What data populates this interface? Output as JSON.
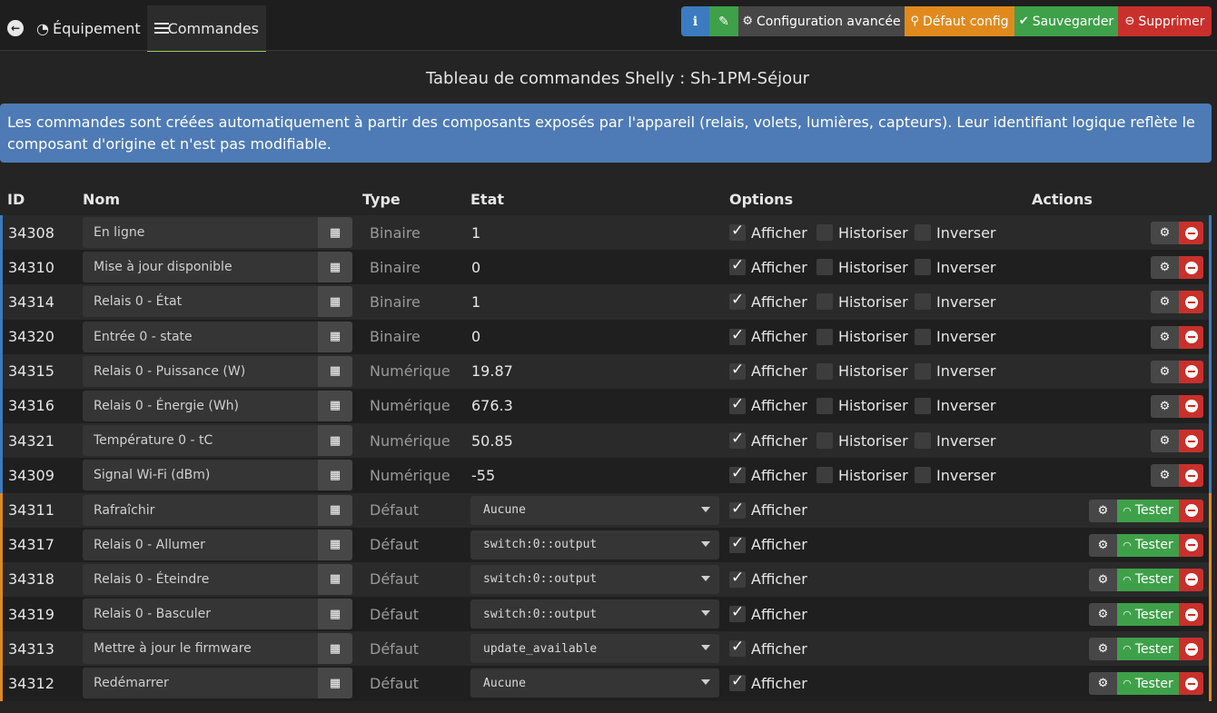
{
  "tabs": {
    "equipment": {
      "label": "Équipement",
      "icon": "tachometer-icon"
    },
    "commands": {
      "label": "Commandes",
      "icon": "list-icon"
    }
  },
  "toolbar": {
    "info_label": "i",
    "config_label": "Configuration avancée",
    "default_label": "Défaut config",
    "save_label": "Sauvegarder",
    "delete_label": "Supprimer"
  },
  "page_title": "Tableau de commandes Shelly : Sh-1PM-Séjour",
  "alert_text": "Les commandes sont créées automatiquement à partir des composants exposés par l'appareil (relais, volets, lumières, capteurs). Leur identifiant logique reflète le composant d'origine et n'est pas modifiable.",
  "table": {
    "headers": {
      "id": "ID",
      "name": "Nom",
      "type": "Type",
      "state": "Etat",
      "options": "Options",
      "actions": "Actions"
    },
    "option_labels": {
      "show": "Afficher",
      "history": "Historiser",
      "invert": "Inverser"
    },
    "test_label": "Tester",
    "info_rows": [
      {
        "id": "34308",
        "name": "En ligne",
        "type": "Binaire",
        "state": "1"
      },
      {
        "id": "34310",
        "name": "Mise à jour disponible",
        "type": "Binaire",
        "state": "0"
      },
      {
        "id": "34314",
        "name": "Relais 0 - État",
        "type": "Binaire",
        "state": "1"
      },
      {
        "id": "34320",
        "name": "Entrée 0 - state",
        "type": "Binaire",
        "state": "0"
      },
      {
        "id": "34315",
        "name": "Relais 0 - Puissance (W)",
        "type": "Numérique",
        "state": "19.87"
      },
      {
        "id": "34316",
        "name": "Relais 0 - Énergie (Wh)",
        "type": "Numérique",
        "state": "676.3"
      },
      {
        "id": "34321",
        "name": "Température 0 - tC",
        "type": "Numérique",
        "state": "50.85"
      },
      {
        "id": "34309",
        "name": "Signal Wi-Fi (dBm)",
        "type": "Numérique",
        "state": "-55"
      }
    ],
    "action_rows": [
      {
        "id": "34311",
        "name": "Rafraîchir",
        "type": "Défaut",
        "value": "Aucune"
      },
      {
        "id": "34317",
        "name": "Relais 0 - Allumer",
        "type": "Défaut",
        "value": "switch:0::output"
      },
      {
        "id": "34318",
        "name": "Relais 0 - Éteindre",
        "type": "Défaut",
        "value": "switch:0::output"
      },
      {
        "id": "34319",
        "name": "Relais 0 - Basculer",
        "type": "Défaut",
        "value": "switch:0::output"
      },
      {
        "id": "34313",
        "name": "Mettre à jour le firmware",
        "type": "Défaut",
        "value": "update_available"
      },
      {
        "id": "34312",
        "name": "Redémarrer",
        "type": "Défaut",
        "value": "Aucune"
      }
    ]
  },
  "colors": {
    "info_accent": "#3b7bbf",
    "action_accent": "#e08a1e",
    "success": "#3fa04a",
    "danger": "#c9302c",
    "warning": "#e08a1e"
  }
}
